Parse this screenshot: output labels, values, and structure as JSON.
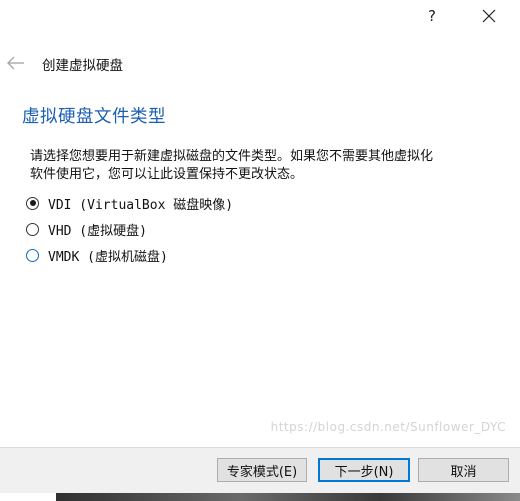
{
  "titlebar": {
    "help_label": "?",
    "close_icon": "close-icon"
  },
  "header": {
    "back_icon": "back-arrow-icon",
    "title": "创建虚拟硬盘"
  },
  "section": {
    "title": "虚拟硬盘文件类型",
    "description_line1": "请选择您想要用于新建虚拟磁盘的文件类型。如果您不需要其他虚拟化",
    "description_line2": "软件使用它，您可以让此设置保持不更改状态。"
  },
  "options": [
    {
      "label": "VDI (VirtualBox 磁盘映像)",
      "checked": true
    },
    {
      "label": "VHD (虚拟硬盘)",
      "checked": false
    },
    {
      "label": "VMDK (虚拟机磁盘)",
      "checked": false
    }
  ],
  "footer": {
    "expert_label": "专家模式(E)",
    "next_label": "下一步(N)",
    "cancel_label": "取消"
  },
  "watermark": "https://blog.csdn.net/Sunflower_DYC"
}
